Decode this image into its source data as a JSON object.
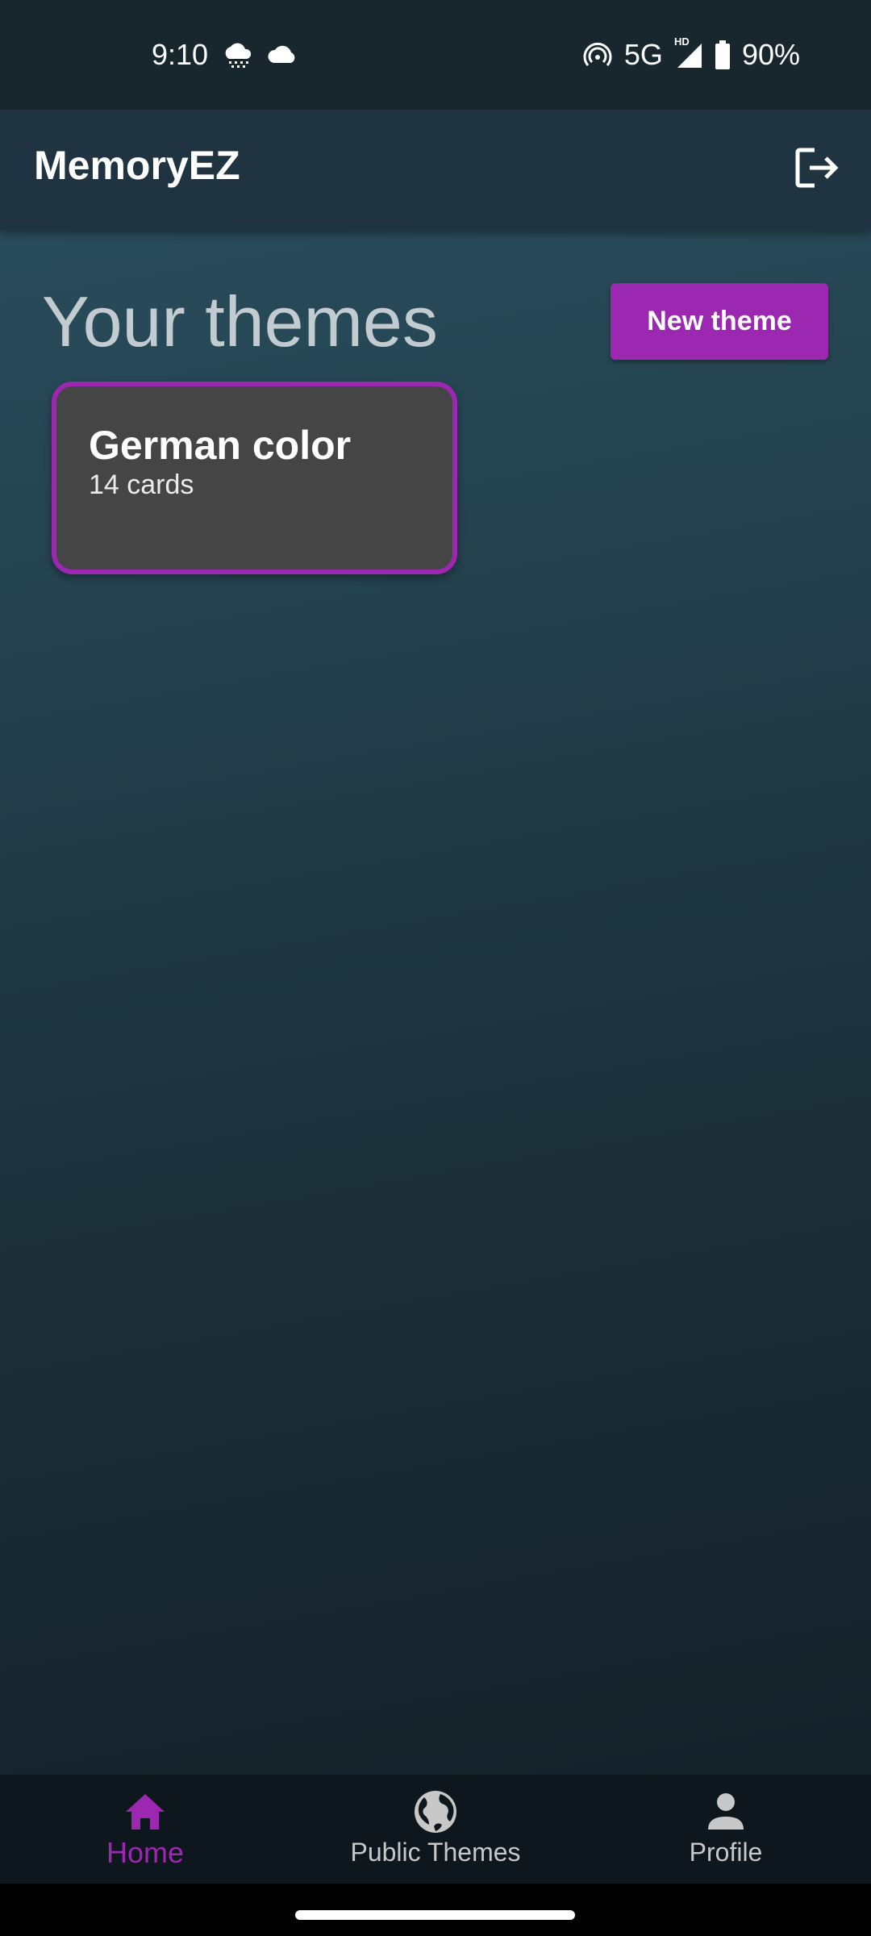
{
  "status_bar": {
    "time": "9:10",
    "network": "5G",
    "hd_label": "HD",
    "battery": "90%",
    "icons": [
      "weather-icon",
      "cloud-icon",
      "hotspot-icon",
      "signal-icon",
      "battery-icon"
    ]
  },
  "app_bar": {
    "title": "MemoryEZ",
    "logout_icon": "logout-icon"
  },
  "main": {
    "section_title": "Your themes",
    "new_theme_label": "New theme",
    "themes": [
      {
        "title": "German color",
        "subtitle": "14 cards"
      }
    ]
  },
  "bottom_nav": {
    "items": [
      {
        "label": "Home",
        "icon": "home-icon",
        "active": true
      },
      {
        "label": "Public Themes",
        "icon": "globe-icon",
        "active": false
      },
      {
        "label": "Profile",
        "icon": "person-icon",
        "active": false
      }
    ]
  },
  "colors": {
    "accent": "#9c27b0",
    "card_bg": "#454545",
    "app_bar_bg": "#1f3440",
    "nav_bg": "#0e171d"
  }
}
